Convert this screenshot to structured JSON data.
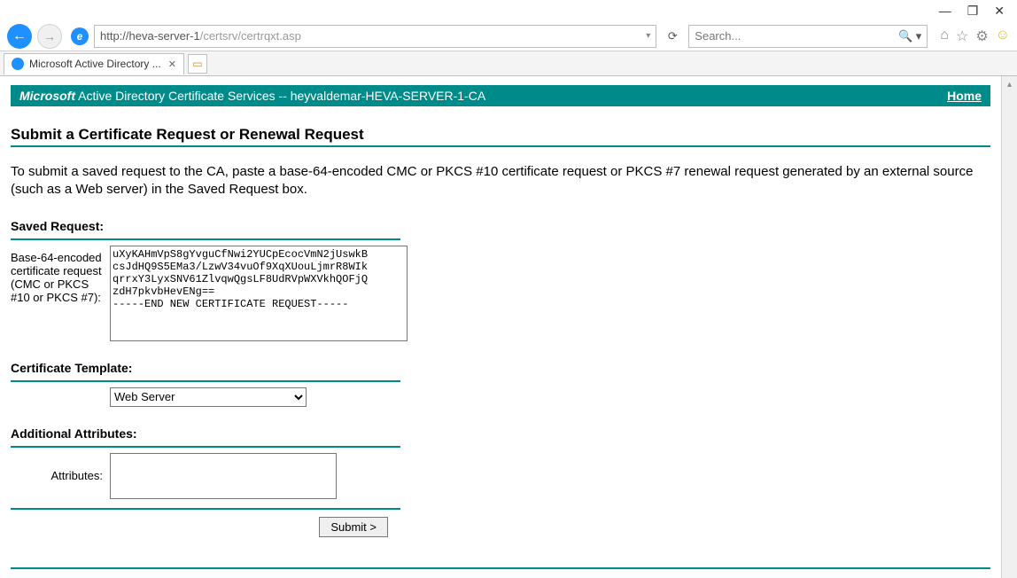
{
  "window": {
    "minimize": "—",
    "maximize": "❐",
    "close": "✕"
  },
  "chrome": {
    "url_prefix": "http://heva-server-1",
    "url_suffix": "/certsrv/certrqxt.asp",
    "search_placeholder": "Search...",
    "tab_title": "Microsoft Active Directory ..."
  },
  "banner": {
    "brand_italic": "Microsoft",
    "brand_rest": " Active Directory Certificate Services  --  heyvaldemar-HEVA-SERVER-1-CA",
    "home": "Home"
  },
  "page": {
    "heading": "Submit a Certificate Request or Renewal Request",
    "description": "To submit a saved request to the CA, paste a base-64-encoded CMC or PKCS #10 certificate request or PKCS #7 renewal request generated by an external source (such as a Web server) in the Saved Request box.",
    "saved_request_label": "Saved Request:",
    "saved_request_rowlabel": "Base-64-encoded certificate request (CMC or PKCS #10 or PKCS #7):",
    "saved_request_value": "uXyKAHmVpS8gYvguCfNwi2YUCpEcocVmN2jUswkB\ncsJdHQ9S5EMa3/LzwV34vuOf9XqXUouLjmrR8WIk\nqrrxY3LyxSNV61ZlvqwQgsLF8UdRVpWXVkhQOFjQ\nzdH7pkvbHevENg==\n-----END NEW CERTIFICATE REQUEST-----",
    "cert_template_label": "Certificate Template:",
    "cert_template_value": "Web Server",
    "attributes_section_label": "Additional Attributes:",
    "attributes_rowlabel": "Attributes:",
    "attributes_value": "",
    "submit_label": "Submit >"
  }
}
